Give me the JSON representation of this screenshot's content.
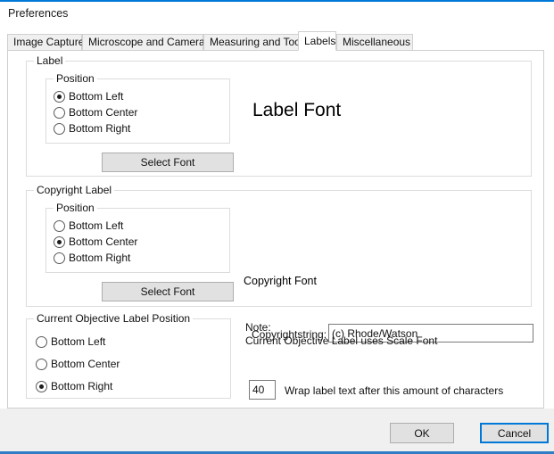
{
  "window": {
    "title": "Preferences",
    "accent_color": "#0078d7",
    "bottom_accent_color": "#2f7dc4"
  },
  "tabs": [
    {
      "label": "Image Capture",
      "selected": false
    },
    {
      "label": "Microscope and Camera",
      "selected": false
    },
    {
      "label": "Measuring and Tools",
      "selected": false
    },
    {
      "label": "Labels",
      "selected": true
    },
    {
      "label": "Miscellaneous",
      "selected": false
    }
  ],
  "label_group": {
    "caption": "Label",
    "position_group": {
      "caption": "Position",
      "options": [
        {
          "label": "Bottom Left",
          "selected": true
        },
        {
          "label": "Bottom Center",
          "selected": false
        },
        {
          "label": "Bottom Right",
          "selected": false
        }
      ]
    },
    "select_font_button": "Select Font",
    "font_preview": "Label Font"
  },
  "copyright_group": {
    "caption": "Copyright Label",
    "position_group": {
      "caption": "Position",
      "options": [
        {
          "label": "Bottom Left",
          "selected": false
        },
        {
          "label": "Bottom Center",
          "selected": true
        },
        {
          "label": "Bottom Right",
          "selected": false
        }
      ]
    },
    "select_font_button": "Select Font",
    "font_preview": "Copyright  Font",
    "copyrightstring_label": "Copyrightstring:",
    "copyrightstring_value": "(c) Rhode/Watson",
    "copyrightstring_placeholder": ""
  },
  "objective_group": {
    "caption": "Current Objective Label Position",
    "options": [
      {
        "label": "Bottom Left",
        "selected": false
      },
      {
        "label": "Bottom Center",
        "selected": false
      },
      {
        "label": "Bottom Right",
        "selected": true
      }
    ]
  },
  "note": {
    "line1": "Note:",
    "line2": "Current Objective Label uses Scale Font"
  },
  "wrap": {
    "value": "40",
    "placeholder": "",
    "label": "Wrap label text after this amount of characters"
  },
  "footer": {
    "ok_label": "OK",
    "cancel_label": "Cancel"
  }
}
